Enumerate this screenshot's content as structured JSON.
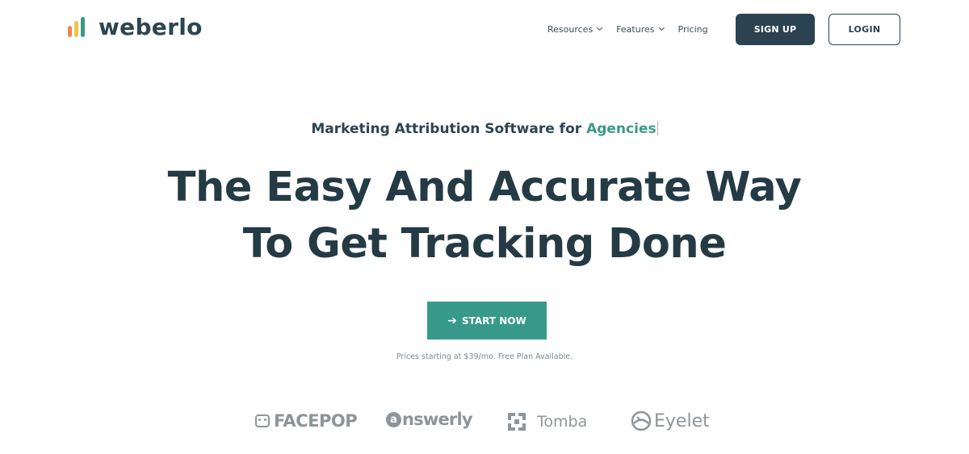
{
  "header": {
    "brand": "weberlo",
    "nav": [
      {
        "label": "Resources",
        "has_dropdown": true
      },
      {
        "label": "Features",
        "has_dropdown": true
      },
      {
        "label": "Pricing",
        "has_dropdown": false
      }
    ],
    "signup_label": "SIGN UP",
    "login_label": "LOGIN"
  },
  "hero": {
    "kicker_prefix": "Marketing Attribution Software for ",
    "kicker_accent": "Agencies",
    "headline_line1": "The Easy And Accurate Way",
    "headline_line2": "To Get Tracking Done",
    "cta_label": "START NOW",
    "cta_icon": "arrow-right-icon",
    "price_note": "Prices starting at $39/mo. Free Plan Available."
  },
  "brands": [
    {
      "name": "FACEPOP",
      "icon": "facepop-icon"
    },
    {
      "name": "nswerly",
      "icon_letter": "a",
      "icon": "answerly-icon"
    },
    {
      "name": "Tomba",
      "icon": "tomba-icon"
    },
    {
      "name": "Eyelet",
      "icon": "eyelet-icon"
    }
  ],
  "colors": {
    "primary_dark": "#2b4350",
    "accent_green": "#36998a",
    "logo_orange": "#e8894a",
    "logo_yellow": "#f2c14e",
    "logo_teal": "#3a9a86",
    "brand_gray": "#8e9599"
  }
}
